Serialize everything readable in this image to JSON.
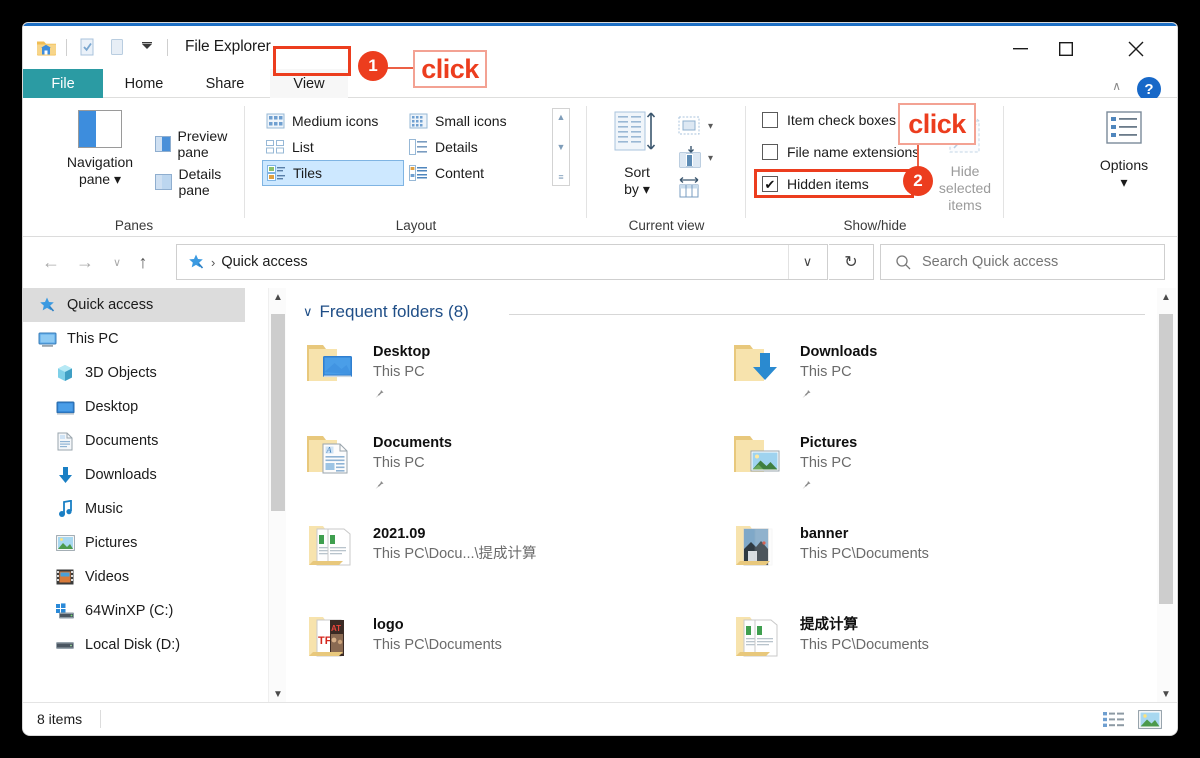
{
  "window": {
    "title": "File Explorer",
    "quick_access_icons": [
      "folder-icon",
      "properties-icon",
      "new-folder-icon",
      "customize-dropdown-icon"
    ],
    "controls": {
      "minimize": "–",
      "maximize": "□",
      "close": "✕"
    },
    "ribbon_collapse": "∧",
    "help": "?"
  },
  "tabs": [
    {
      "label": "File",
      "id": "file"
    },
    {
      "label": "Home",
      "id": "home"
    },
    {
      "label": "Share",
      "id": "share"
    },
    {
      "label": "View",
      "id": "view"
    }
  ],
  "ribbon": {
    "groups": [
      {
        "label": "Panes"
      },
      {
        "label": "Layout"
      },
      {
        "label": "Current view"
      },
      {
        "label": "Show/hide"
      }
    ],
    "panes": {
      "navigation_pane": "Navigation\npane",
      "navigation_pane_line1": "Navigation",
      "navigation_pane_line2": "pane",
      "preview_pane": "Preview pane",
      "details_pane": "Details pane"
    },
    "layout": {
      "items": [
        {
          "label": "Medium icons",
          "selected": false
        },
        {
          "label": "Small icons",
          "selected": false
        },
        {
          "label": "List",
          "selected": false
        },
        {
          "label": "Details",
          "selected": false
        },
        {
          "label": "Tiles",
          "selected": true
        },
        {
          "label": "Content",
          "selected": false
        }
      ]
    },
    "current_view": {
      "sort_by_line1": "Sort",
      "sort_by_line2": "by",
      "group_by": "group-by-icon",
      "add_columns": "add-columns-icon",
      "size_all_columns": "size-all-columns-to-fit-icon"
    },
    "show_hide": {
      "item_check_boxes": {
        "label": "Item check boxes",
        "checked": false
      },
      "file_name_extensions": {
        "label": "File name extensions",
        "checked": false
      },
      "hidden_items": {
        "label": "Hidden items",
        "checked": true
      },
      "hide_selected_line1": "Hide selected",
      "hide_selected_line2": "items"
    },
    "options": {
      "label": "Options",
      "caret": "▾"
    }
  },
  "addressbar": {
    "back": "←",
    "forward": "→",
    "recent": "∨",
    "up": "↑",
    "crumb_icon": "quick-access-star-icon",
    "crumb_sep": "›",
    "path": "Quick access",
    "dropdown": "∨",
    "refresh": "↻",
    "search_placeholder": "Search Quick access",
    "search_value": ""
  },
  "sidebar": {
    "items": [
      {
        "label": "Quick access",
        "icon": "star-pin-icon",
        "level": 0,
        "selected": true
      },
      {
        "label": "This PC",
        "icon": "monitor-icon",
        "level": 0,
        "selected": false
      },
      {
        "label": "3D Objects",
        "icon": "3d-objects-icon",
        "level": 1,
        "selected": false
      },
      {
        "label": "Desktop",
        "icon": "desktop-icon",
        "level": 1,
        "selected": false
      },
      {
        "label": "Documents",
        "icon": "documents-icon",
        "level": 1,
        "selected": false
      },
      {
        "label": "Downloads",
        "icon": "downloads-icon",
        "level": 1,
        "selected": false
      },
      {
        "label": "Music",
        "icon": "music-note-icon",
        "level": 1,
        "selected": false
      },
      {
        "label": "Pictures",
        "icon": "pictures-icon",
        "level": 1,
        "selected": false
      },
      {
        "label": "Videos",
        "icon": "videos-icon",
        "level": 1,
        "selected": false
      },
      {
        "label": "64WinXP  (C:)",
        "icon": "windows-drive-icon",
        "level": 1,
        "selected": false
      },
      {
        "label": "Local Disk (D:)",
        "icon": "drive-icon",
        "level": 1,
        "selected": false
      }
    ]
  },
  "content": {
    "group_chevron": "∨",
    "group_title": "Frequent folders (8)",
    "tiles": [
      {
        "name": "Desktop",
        "sub": "This PC",
        "icon": "folder-desktop-icon",
        "pinned": true
      },
      {
        "name": "Downloads",
        "sub": "This PC",
        "icon": "folder-downloads-icon",
        "pinned": true
      },
      {
        "name": "Documents",
        "sub": "This PC",
        "icon": "folder-documents-icon",
        "pinned": true
      },
      {
        "name": "Pictures",
        "sub": "This PC",
        "icon": "folder-pictures-icon",
        "pinned": true
      },
      {
        "name": "2021.09",
        "sub": "This PC\\Docu...\\提成计算",
        "icon": "folder-docs-preview-icon",
        "pinned": false
      },
      {
        "name": "banner",
        "sub": "This PC\\Documents",
        "icon": "folder-photo-preview-icon",
        "pinned": false
      },
      {
        "name": "logo",
        "sub": "This PC\\Documents",
        "icon": "folder-logo-preview-icon",
        "pinned": false
      },
      {
        "name": "提成计算",
        "sub": "This PC\\Documents",
        "icon": "folder-docs-preview-icon",
        "pinned": false
      }
    ]
  },
  "statusbar": {
    "count": "8 items",
    "view_details": "details-view-icon",
    "view_large_icons": "large-icons-view-icon"
  },
  "annotations": [
    {
      "id": 1,
      "badge": "1",
      "label": "click",
      "target": "view-tab"
    },
    {
      "id": 2,
      "badge": "2",
      "label": "click",
      "target": "hidden-items-checkbox"
    }
  ],
  "colors": {
    "accent_blue": "#1768c8",
    "file_tab_teal": "#2b9ba3",
    "annotation_red": "#ec3d1e",
    "selection_blue": "#cde8ff",
    "group_title_blue": "#1f4e87"
  }
}
